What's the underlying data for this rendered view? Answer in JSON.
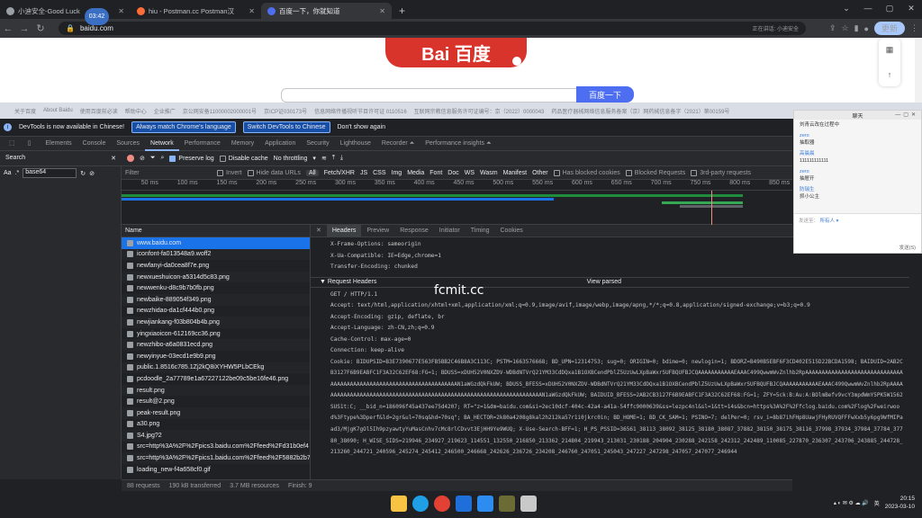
{
  "tabs": [
    {
      "title": "小迪安全-Good Luck",
      "active": false
    },
    {
      "title": "hiu - Postman.cc Postman汉",
      "active": false
    },
    {
      "title": "百度一下，你就知道",
      "active": true
    }
  ],
  "time_badge": "03:42",
  "address": {
    "url": "baidu.com",
    "notice": "正在讲话: 小迪安全",
    "update_label": "更新"
  },
  "page": {
    "logo_text": "Bai 百度",
    "search_button": "百度一下",
    "top_nav": [
      "关于百度",
      "About Baidu",
      "使用百度前必读",
      "帮助中心",
      "企业推广",
      "京公网安备11000002000001号",
      "京ICP证030173号",
      "信息网络传播视听节目许可证 0110516",
      "互联网宗教信息服务许可证编号：京（2022）0000043",
      "药品医疗器械网络信息服务备案（京）网药械信息备字（2021）第00159号"
    ]
  },
  "infobar": {
    "message": "DevTools is now available in Chinese!",
    "btn1": "Always match Chrome's language",
    "btn2": "Switch DevTools to Chinese",
    "dismiss": "Don't show again"
  },
  "devtools_tabs": [
    "Elements",
    "Console",
    "Sources",
    "Network",
    "Performance",
    "Memory",
    "Application",
    "Security",
    "Lighthouse",
    "Recorder ⏶",
    "Performance insights ⏶"
  ],
  "network_toolbar": {
    "search_label": "Search",
    "preserve_log": "Preserve log",
    "disable_cache": "Disable cache",
    "throttling": "No throttling"
  },
  "search_pane": {
    "aa": "Aa",
    "regex": ".*",
    "query": "base64"
  },
  "filter_bar": {
    "placeholder": "Filter",
    "invert": "Invert",
    "hide_data_urls": "Hide data URLs",
    "types": [
      "All",
      "Fetch/XHR",
      "JS",
      "CSS",
      "Img",
      "Media",
      "Font",
      "Doc",
      "WS",
      "Wasm",
      "Manifest",
      "Other"
    ],
    "has_blocked_cookies": "Has blocked cookies",
    "blocked_requests": "Blocked Requests",
    "third_party": "3rd-party requests"
  },
  "timeline_ticks": [
    "50 ms",
    "100 ms",
    "150 ms",
    "200 ms",
    "250 ms",
    "300 ms",
    "350 ms",
    "400 ms",
    "450 ms",
    "500 ms",
    "550 ms",
    "600 ms",
    "650 ms",
    "700 ms",
    "750 ms",
    "800 ms",
    "850 ms"
  ],
  "request_list": {
    "header": "Name",
    "items": [
      "www.baidu.com",
      "iconfont-fa013548a9.woff2",
      "newfanyi-da0cea8f7e.png",
      "newxueshuicon-a5314d5c83.png",
      "newwenku-d8c9b7b0fb.png",
      "newbaike-889054f349.png",
      "newzhidao-da1cf444b0.png",
      "newjiankang-f03b804b4b.png",
      "yingxiaoicon-612169cc36.png",
      "newzhibo-a6a0831ecd.png",
      "newyinyue-03ecd1e9b9.png",
      "public.1.8516c785.1Zj2kQ8iXYHW5PLbCEkg",
      "pcdoodle_2a77789e1a67227122be09c5be16fe46.png",
      "result.png",
      "result@2.png",
      "peak-result.png",
      "a30.png",
      "S4.jpg?2",
      "src=http%3A%2F%2Fpics3.baidu.com%2Ffeed%2Fd31b0ef4",
      "src=http%3A%2F%2Fpics1.baidu.com%2Ffeed%2F5882b2b7",
      "loading_new-f4a658cf0.gif"
    ]
  },
  "detail": {
    "tabs": [
      "Headers",
      "Preview",
      "Response",
      "Initiator",
      "Timing",
      "Cookies"
    ],
    "response_headers_tail": [
      "X-Frame-Options: sameorigin",
      "X-Ua-Compatible: IE=Edge,chrome=1",
      "Transfer-Encoding: chunked"
    ],
    "request_headers_title": "▼ Request Headers",
    "view_parsed": "View parsed",
    "request_lines": [
      "GET / HTTP/1.1",
      "Accept: text/html,application/xhtml+xml,application/xml;q=0.9,image/avif,image/webp,image/apng,*/*;q=0.8,application/signed-exchange;v=b3;q=0.9",
      "Accept-Encoding: gzip, deflate, br",
      "Accept-Language: zh-CN,zh;q=0.9",
      "Cache-Control: max-age=0",
      "Connection: keep-alive"
    ],
    "cookie": "Cookie: BIDUPSID=B3E7390677E563FB5BB2C46B8A3C113C; PSTM=1663576668; BD_UPN=12314753; sug=0; ORIGIN=0; bdime=0; newlogin=1; BDORZ=B490B5EBF6F3CD402E515D22BCDA1598; BAIDUID=2AB2CB3127F6B9EABFC1F3A32C62EF68:FG=1; BDUSS=xDUH52V0NXZDV-WDBdNTVrQ21YM33CdDQxa1B1OXBCendPblZ5UzUwLXpBaWxrSUFBQUFBJCQAAAAAAAAAAAEAAAC499QwwmWvZnlhb2RpAAAAAAAAAAAAAAAAAAAAAAAAAAAAAAAAAAAAAAAAAAAAAAAAAAAAAAAAAAAAAAAAAAAAAN1aWGzdQkFkUW; BDUSS_BFESS=xDUH52V0NXZDV-WDBdNTVrQ21YM33CdDQxa1B1OXBCendPblZ5UzUwLXpBaWxrSUFBQUFBJCQAAAAAAAAAAAEAAAC499QwwmWvZnlhb2RpAAAAAAAAAAAAAAAAAAAAAAAAAAAAAAAAAAAAAAAAAAAAAAAAAAAAAAAAAAAAAAAAAAAAAN1aWGzdQkFkUW; BAIDUID_BFESS=2AB2CB3127F6B9EABFC1F3A32C62EF68:FG=1; ZFY=5ck:B:Au:A:BOlmBefv9vcY3mpdWmY5PK5W1562SUS1t:C; __bid_n=186096f45a437ee75d4207; RT=\"z=1&dm=baidu.com&si=2ec10dcf-404c-42a4-a41a-54ffc9000639&ss=lezpc4nl&sl=1&tt=14s&bcn=https%3A%2F%2Ffclog.baidu.com%2Flog%2Fweirwood%3Ftype%3Dperf&ld=2gr&ul=70sq&hd=70sq\"; BA_HECTOR=2k80a4208g8kal2h212ka57r1i0jkrc0in; BD_HOME=1; BD_CK_SAM=1; PSINO=7; delPer=0; rsv_i=8b87ihFHp8UawjFHyRUVQFFFwXxb5y6pg9WfMIPaad3/MjgK7gOl5Ih9pzyawtyYuMasCnhv7cMc8rlCDvvt3EjHH9Ye9WUQ; X-Use-Search-BFF=1; H_PS_PSSID=36561_38113_38092_38125_38180_38087_37882_38150_38175_38116_37998_37934_37984_37784_37780_38090; H_WISE_SIDS=219946_234927_219623_114551_132550_216850_213362_214804_219943_213031_230188_204904_230288_242158_242312_242489_110085_227870_236307_243706_243885_244728_213260_244721_240596_245274_245412_246500_246668_242626_236726_234208_246760_247051_245043_247227_247298_247057_247077_246944"
  },
  "status_bar": {
    "requests": "88 requests",
    "transferred": "190 kB transferred",
    "resources": "3.7 MB resources",
    "finish": "Finish: 9"
  },
  "watermark": "fcmit.cc",
  "chat": {
    "title": "聊天",
    "messages": [
      {
        "who": "",
        "text": "刘青云改在过程中"
      },
      {
        "who": "zero",
        "text": "抽取器"
      },
      {
        "who": "高晨晨",
        "text": "111111111111"
      },
      {
        "who": "zero",
        "text": "抽屉开"
      },
      {
        "who": "防瑞生",
        "text": "抓小公主"
      }
    ],
    "to_label": "发送至：",
    "to_value": "所有人 ▾",
    "send": "发送(S)"
  },
  "taskbar": {
    "time": "20:15",
    "date": "2023-03-10"
  }
}
